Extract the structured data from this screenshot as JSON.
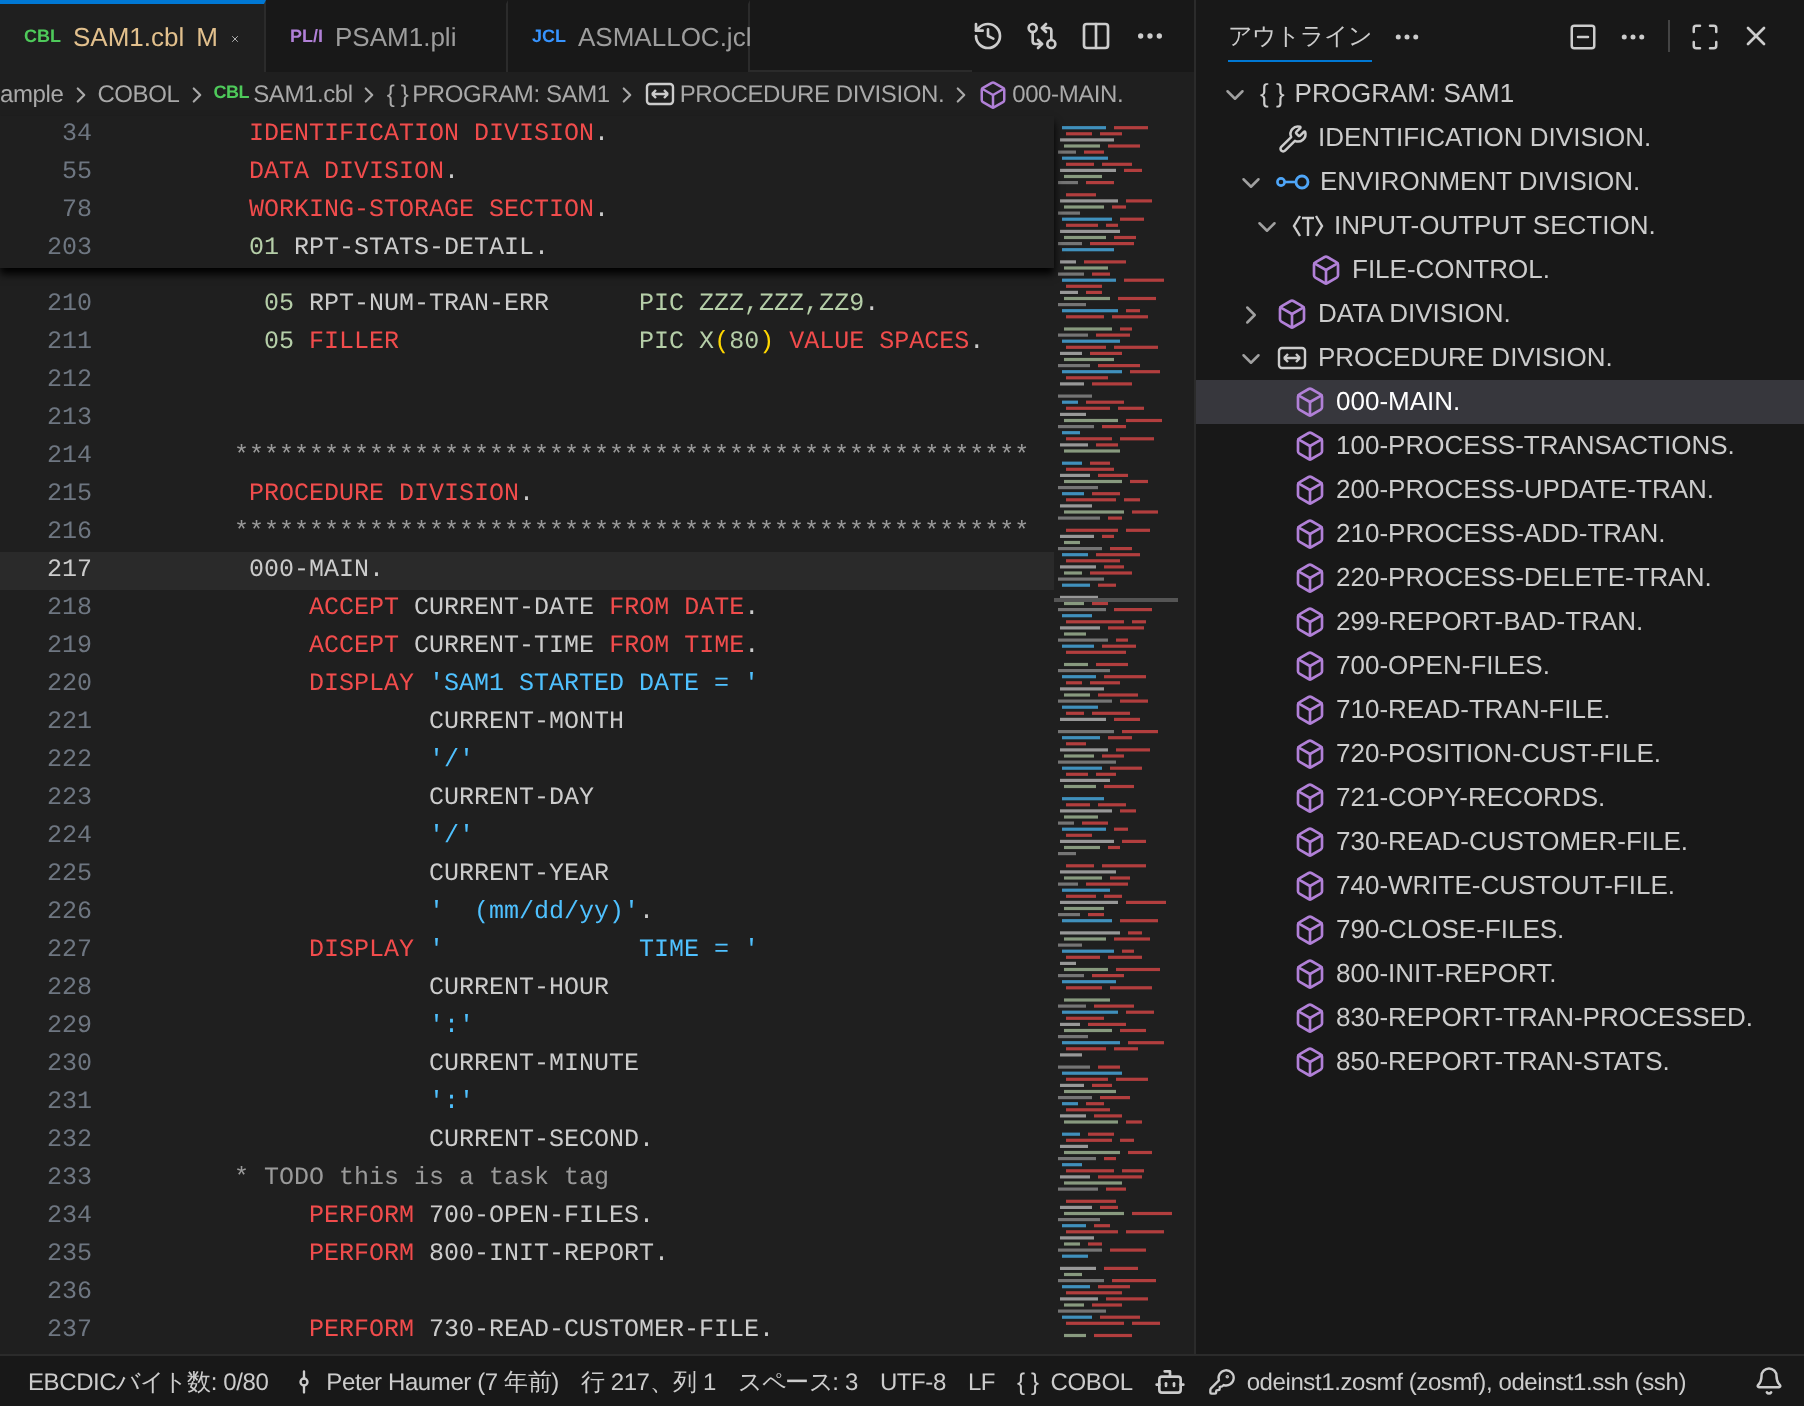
{
  "tabs": [
    {
      "badge": "CBL",
      "kind": "cobol",
      "label": "SAM1.cbl",
      "modified": "M",
      "selected": true
    },
    {
      "badge": "PL/I",
      "kind": "pli",
      "label": "PSAM1.pli",
      "selected": false
    },
    {
      "badge": "JCL",
      "kind": "jcl",
      "label": "ASMALLOC.jcl",
      "selected": false
    }
  ],
  "breadcrumb": [
    {
      "kind": "folder",
      "label": "ample"
    },
    {
      "kind": "folder",
      "label": "COBOL"
    },
    {
      "kind": "file",
      "badge": "CBL",
      "label": "SAM1.cbl"
    },
    {
      "kind": "program",
      "icon_text": "{ }",
      "label": "PROGRAM: SAM1"
    },
    {
      "kind": "procedure",
      "label": "PROCEDURE DIVISION."
    },
    {
      "kind": "paragraph",
      "label": "000-MAIN."
    }
  ],
  "sticky_scroll": [
    {
      "number": "34",
      "tokens": [
        {
          "text": "       IDENTIFICATION DIVISION",
          "kind": "keyword"
        },
        {
          "text": ".",
          "kind": "plain"
        }
      ]
    },
    {
      "number": "55",
      "tokens": [
        {
          "text": "       DATA DIVISION",
          "kind": "keyword"
        },
        {
          "text": ".",
          "kind": "plain"
        }
      ]
    },
    {
      "number": "78",
      "tokens": [
        {
          "text": "       WORKING-STORAGE SECTION",
          "kind": "keyword"
        },
        {
          "text": ".",
          "kind": "plain"
        }
      ]
    },
    {
      "number": "203",
      "tokens": [
        {
          "text": "       01",
          "kind": "number"
        },
        {
          "text": " RPT-STATS-DETAIL.",
          "kind": "plain"
        }
      ]
    }
  ],
  "code_lines": [
    {
      "number": "210",
      "current": false,
      "tokens": [
        {
          "text": "        05",
          "kind": "number"
        },
        {
          "text": " RPT-NUM-TRAN-ERR      ",
          "kind": "plain"
        },
        {
          "text": "PIC ZZZ,ZZZ,ZZ9",
          "kind": "number"
        },
        {
          "text": ".",
          "kind": "plain"
        }
      ]
    },
    {
      "number": "211",
      "current": false,
      "tokens": [
        {
          "text": "        05",
          "kind": "number"
        },
        {
          "text": " FILLER",
          "kind": "keyword"
        },
        {
          "text": "                PIC X",
          "kind": "number"
        },
        {
          "text": "(",
          "kind": "paren"
        },
        {
          "text": "80",
          "kind": "number"
        },
        {
          "text": ")",
          "kind": "paren"
        },
        {
          "text": " VALUE SPACES",
          "kind": "keyword"
        },
        {
          "text": ".",
          "kind": "plain"
        }
      ]
    },
    {
      "number": "212",
      "current": false
    },
    {
      "number": "213",
      "current": false
    },
    {
      "number": "214",
      "current": false,
      "tokens": [
        {
          "text": "      *****************************************************",
          "kind": "comment"
        }
      ]
    },
    {
      "number": "215",
      "current": false,
      "tokens": [
        {
          "text": "       PROCEDURE DIVISION",
          "kind": "keyword"
        },
        {
          "text": ".",
          "kind": "plain"
        }
      ]
    },
    {
      "number": "216",
      "current": false,
      "tokens": [
        {
          "text": "      *****************************************************",
          "kind": "comment"
        }
      ]
    },
    {
      "number": "217",
      "current": true,
      "tokens": [
        {
          "text": "       000-MAIN.",
          "kind": "plain"
        }
      ]
    },
    {
      "number": "218",
      "current": false,
      "tokens": [
        {
          "text": "           ACCEPT",
          "kind": "keyword"
        },
        {
          "text": " CURRENT-DATE ",
          "kind": "plain"
        },
        {
          "text": "FROM DATE",
          "kind": "keyword"
        },
        {
          "text": ".",
          "kind": "plain"
        }
      ]
    },
    {
      "number": "219",
      "current": false,
      "tokens": [
        {
          "text": "           ACCEPT",
          "kind": "keyword"
        },
        {
          "text": " CURRENT-TIME ",
          "kind": "plain"
        },
        {
          "text": "FROM TIME",
          "kind": "keyword"
        },
        {
          "text": ".",
          "kind": "plain"
        }
      ]
    },
    {
      "number": "220",
      "current": false,
      "tokens": [
        {
          "text": "           DISPLAY",
          "kind": "keyword"
        },
        {
          "text": " 'SAM1 STARTED DATE = '",
          "kind": "string"
        }
      ]
    },
    {
      "number": "221",
      "current": false,
      "tokens": [
        {
          "text": "                   CURRENT-MONTH",
          "kind": "plain"
        }
      ]
    },
    {
      "number": "222",
      "current": false,
      "tokens": [
        {
          "text": "                   '/'",
          "kind": "string"
        }
      ]
    },
    {
      "number": "223",
      "current": false,
      "tokens": [
        {
          "text": "                   CURRENT-DAY",
          "kind": "plain"
        }
      ]
    },
    {
      "number": "224",
      "current": false,
      "tokens": [
        {
          "text": "                   '/'",
          "kind": "string"
        }
      ]
    },
    {
      "number": "225",
      "current": false,
      "tokens": [
        {
          "text": "                   CURRENT-YEAR",
          "kind": "plain"
        }
      ]
    },
    {
      "number": "226",
      "current": false,
      "tokens": [
        {
          "text": "                   '  (mm/dd/yy)'",
          "kind": "string"
        },
        {
          "text": ".",
          "kind": "plain"
        }
      ]
    },
    {
      "number": "227",
      "current": false,
      "tokens": [
        {
          "text": "           DISPLAY",
          "kind": "keyword"
        },
        {
          "text": " '             TIME = '",
          "kind": "string"
        }
      ]
    },
    {
      "number": "228",
      "current": false,
      "tokens": [
        {
          "text": "                   CURRENT-HOUR",
          "kind": "plain"
        }
      ]
    },
    {
      "number": "229",
      "current": false,
      "tokens": [
        {
          "text": "                   ':'",
          "kind": "string"
        }
      ]
    },
    {
      "number": "230",
      "current": false,
      "tokens": [
        {
          "text": "                   CURRENT-MINUTE",
          "kind": "plain"
        }
      ]
    },
    {
      "number": "231",
      "current": false,
      "tokens": [
        {
          "text": "                   ':'",
          "kind": "string"
        }
      ]
    },
    {
      "number": "232",
      "current": false,
      "tokens": [
        {
          "text": "                   CURRENT-SECOND.",
          "kind": "plain"
        }
      ]
    },
    {
      "number": "233",
      "current": false,
      "tokens": [
        {
          "text": "      * TODO this is a task tag",
          "kind": "comment"
        }
      ]
    },
    {
      "number": "234",
      "current": false,
      "tokens": [
        {
          "text": "           PERFORM",
          "kind": "keyword"
        },
        {
          "text": " 700-OPEN-FILES.",
          "kind": "plain"
        }
      ]
    },
    {
      "number": "235",
      "current": false,
      "tokens": [
        {
          "text": "           PERFORM",
          "kind": "keyword"
        },
        {
          "text": " 800-INIT-REPORT.",
          "kind": "plain"
        }
      ]
    },
    {
      "number": "236",
      "current": false
    },
    {
      "number": "237",
      "current": false,
      "tokens": [
        {
          "text": "           PERFORM",
          "kind": "keyword"
        },
        {
          "text": " 730-READ-CUSTOMER-FILE.",
          "kind": "plain"
        }
      ]
    }
  ],
  "outline": {
    "title": "アウトライン",
    "items": [
      {
        "kind": "program",
        "icon_text": "{ }",
        "label": "PROGRAM: SAM1",
        "expanded": true,
        "selected": false,
        "children": [
          {
            "kind": "identification",
            "label": "IDENTIFICATION DIVISION.",
            "selected": false
          },
          {
            "kind": "environment",
            "label": "ENVIRONMENT DIVISION.",
            "expanded": true,
            "selected": false,
            "children": [
              {
                "kind": "section",
                "label": "INPUT-OUTPUT SECTION.",
                "expanded": true,
                "selected": false,
                "children": [
                  {
                    "kind": "paragraph",
                    "label": "FILE-CONTROL.",
                    "selected": false
                  }
                ]
              }
            ]
          },
          {
            "kind": "paragraph",
            "label": "DATA DIVISION.",
            "expanded": false,
            "selected": false
          },
          {
            "kind": "procedure",
            "label": "PROCEDURE DIVISION.",
            "expanded": true,
            "selected": false,
            "children": [
              {
                "kind": "paragraph",
                "label": "000-MAIN.",
                "selected": true
              },
              {
                "kind": "paragraph",
                "label": "100-PROCESS-TRANSACTIONS.",
                "selected": false
              },
              {
                "kind": "paragraph",
                "label": "200-PROCESS-UPDATE-TRAN.",
                "selected": false
              },
              {
                "kind": "paragraph",
                "label": "210-PROCESS-ADD-TRAN.",
                "selected": false
              },
              {
                "kind": "paragraph",
                "label": "220-PROCESS-DELETE-TRAN.",
                "selected": false
              },
              {
                "kind": "paragraph",
                "label": "299-REPORT-BAD-TRAN.",
                "selected": false
              },
              {
                "kind": "paragraph",
                "label": "700-OPEN-FILES.",
                "selected": false
              },
              {
                "kind": "paragraph",
                "label": "710-READ-TRAN-FILE.",
                "selected": false
              },
              {
                "kind": "paragraph",
                "label": "720-POSITION-CUST-FILE.",
                "selected": false
              },
              {
                "kind": "paragraph",
                "label": "721-COPY-RECORDS.",
                "selected": false
              },
              {
                "kind": "paragraph",
                "label": "730-READ-CUSTOMER-FILE.",
                "selected": false
              },
              {
                "kind": "paragraph",
                "label": "740-WRITE-CUSTOUT-FILE.",
                "selected": false
              },
              {
                "kind": "paragraph",
                "label": "790-CLOSE-FILES.",
                "selected": false
              },
              {
                "kind": "paragraph",
                "label": "800-INIT-REPORT.",
                "selected": false
              },
              {
                "kind": "paragraph",
                "label": "830-REPORT-TRAN-PROCESSED.",
                "selected": false
              },
              {
                "kind": "paragraph",
                "label": "850-REPORT-TRAN-STATS.",
                "selected": false
              }
            ]
          }
        ]
      }
    ]
  },
  "status_bar": [
    {
      "kind": "text",
      "label": "EBCDICバイト数: 0/80"
    },
    {
      "kind": "commit",
      "label": "Peter Haumer (7 年前)"
    },
    {
      "kind": "text",
      "label": "行 217、列 1"
    },
    {
      "kind": "text",
      "label": "スペース: 3"
    },
    {
      "kind": "text",
      "label": "UTF-8"
    },
    {
      "kind": "text",
      "label": "LF"
    },
    {
      "kind": "language",
      "icon_text": "{ }",
      "label": "COBOL"
    },
    {
      "kind": "copilot"
    },
    {
      "kind": "connection",
      "label": "odeinst1.zosmf (zosmf), odeinst1.ssh (ssh)"
    },
    {
      "kind": "bell"
    }
  ]
}
